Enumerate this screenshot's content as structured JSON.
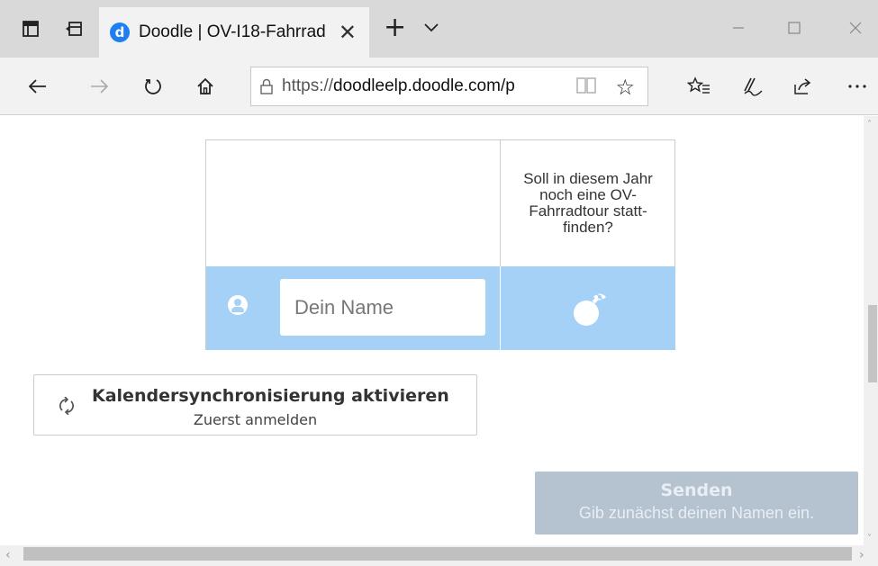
{
  "browser": {
    "tab_title": "Doodle | OV-I18-Fahrrad",
    "tab_favicon_letter": "d",
    "url_scheme": "https://",
    "url_host": "doodleelp.doodle.com/p"
  },
  "poll": {
    "question": "Soll in diesem Jahr noch eine OV-Fahrradtour statt-finden?",
    "name_placeholder": "Dein Name"
  },
  "calendar_sync": {
    "title": "Kalendersynchronisierung aktivieren",
    "subtitle": "Zuerst anmelden"
  },
  "send": {
    "label": "Senden",
    "hint": "Gib zunächst deinen Namen ein."
  },
  "colors": {
    "accent": "#1d7ff2",
    "row_highlight": "#a6d1f7",
    "disabled_button": "#b5c3d0"
  }
}
